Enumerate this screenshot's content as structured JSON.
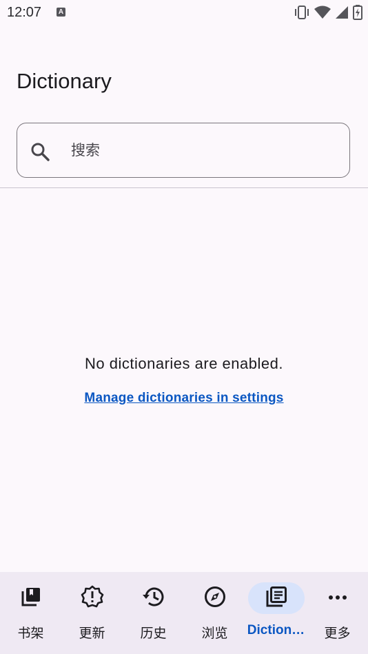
{
  "status_bar": {
    "time": "12:07",
    "notification_icon": "A"
  },
  "page": {
    "title": "Dictionary"
  },
  "search": {
    "placeholder": "搜索"
  },
  "empty_state": {
    "message": "No dictionaries are enabled.",
    "link": "Manage dictionaries in settings"
  },
  "bottom_nav": {
    "items": [
      {
        "label": "书架",
        "icon": "library-icon",
        "active": false
      },
      {
        "label": "更新",
        "icon": "updates-icon",
        "active": false
      },
      {
        "label": "历史",
        "icon": "history-icon",
        "active": false
      },
      {
        "label": "浏览",
        "icon": "compass-icon",
        "active": false
      },
      {
        "label": "Diction…",
        "icon": "dictionary-icon",
        "active": true
      },
      {
        "label": "更多",
        "icon": "more-icon",
        "active": false
      }
    ]
  },
  "colors": {
    "accent": "#0b57c2",
    "nav_background": "#efe9f3",
    "active_pill": "#d8e3fb",
    "background": "#fcf8fc"
  }
}
